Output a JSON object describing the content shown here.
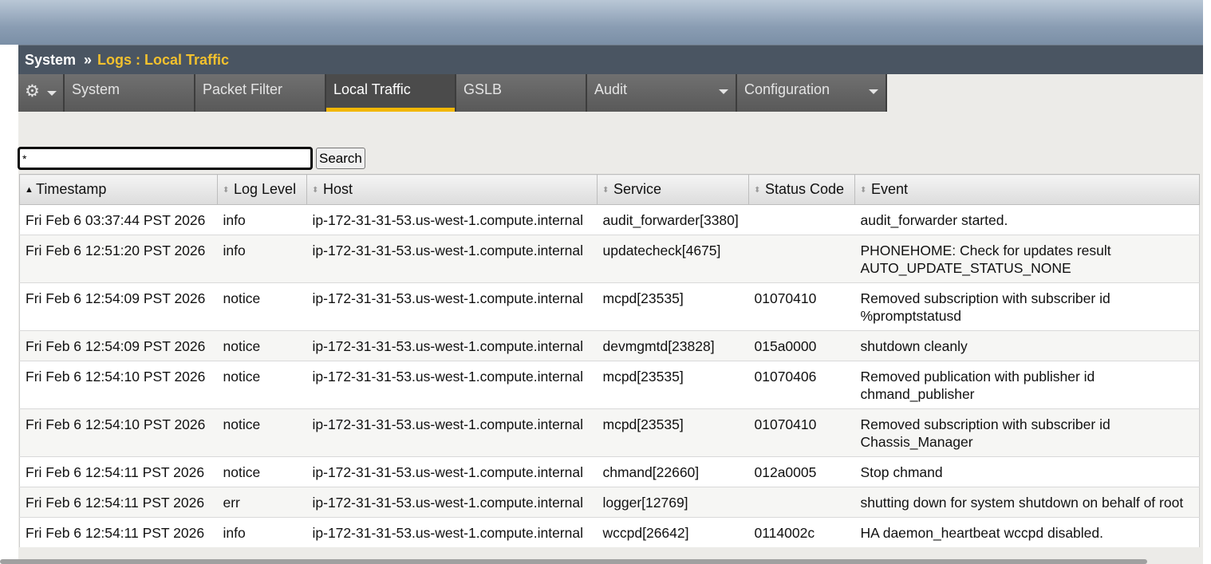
{
  "breadcrumb": {
    "root": "System",
    "separator": "››",
    "current": "Logs : Local Traffic"
  },
  "tabs": [
    {
      "label": "",
      "icon": "gear-icon",
      "has_dropdown": true
    },
    {
      "label": "System",
      "has_dropdown": false
    },
    {
      "label": "Packet Filter",
      "has_dropdown": false
    },
    {
      "label": "Local Traffic",
      "has_dropdown": false,
      "active": true
    },
    {
      "label": "GSLB",
      "has_dropdown": false
    },
    {
      "label": "Audit",
      "has_dropdown": true
    },
    {
      "label": "Configuration",
      "has_dropdown": true
    }
  ],
  "search": {
    "value": "*",
    "button_label": "Search"
  },
  "table": {
    "columns": [
      "Timestamp",
      "Log Level",
      "Host",
      "Service",
      "Status Code",
      "Event"
    ],
    "sorted_column": "Timestamp",
    "rows": [
      {
        "timestamp": "Fri Feb 6 03:37:44 PST 2026",
        "level": "info",
        "host": "ip-172-31-31-53.us-west-1.compute.internal",
        "service": "audit_forwarder[3380]",
        "status_code": "",
        "event": "audit_forwarder started."
      },
      {
        "timestamp": "Fri Feb 6 12:51:20 PST 2026",
        "level": "info",
        "host": "ip-172-31-31-53.us-west-1.compute.internal",
        "service": "updatecheck[4675]",
        "status_code": "",
        "event": "PHONEHOME: Check for updates result AUTO_UPDATE_STATUS_NONE"
      },
      {
        "timestamp": "Fri Feb 6 12:54:09 PST 2026",
        "level": "notice",
        "host": "ip-172-31-31-53.us-west-1.compute.internal",
        "service": "mcpd[23535]",
        "status_code": "01070410",
        "event": "Removed subscription with subscriber id %promptstatusd"
      },
      {
        "timestamp": "Fri Feb 6 12:54:09 PST 2026",
        "level": "notice",
        "host": "ip-172-31-31-53.us-west-1.compute.internal",
        "service": "devmgmtd[23828]",
        "status_code": "015a0000",
        "event": "shutdown cleanly"
      },
      {
        "timestamp": "Fri Feb 6 12:54:10 PST 2026",
        "level": "notice",
        "host": "ip-172-31-31-53.us-west-1.compute.internal",
        "service": "mcpd[23535]",
        "status_code": "01070406",
        "event": "Removed publication with publisher id chmand_publisher"
      },
      {
        "timestamp": "Fri Feb 6 12:54:10 PST 2026",
        "level": "notice",
        "host": "ip-172-31-31-53.us-west-1.compute.internal",
        "service": "mcpd[23535]",
        "status_code": "01070410",
        "event": "Removed subscription with subscriber id Chassis_Manager"
      },
      {
        "timestamp": "Fri Feb 6 12:54:11 PST 2026",
        "level": "notice",
        "host": "ip-172-31-31-53.us-west-1.compute.internal",
        "service": "chmand[22660]",
        "status_code": "012a0005",
        "event": "Stop chmand"
      },
      {
        "timestamp": "Fri Feb 6 12:54:11 PST 2026",
        "level": "err",
        "host": "ip-172-31-31-53.us-west-1.compute.internal",
        "service": "logger[12769]",
        "status_code": "",
        "event": "shutting down for system shutdown on behalf of root"
      },
      {
        "timestamp": "Fri Feb 6 12:54:11 PST 2026",
        "level": "info",
        "host": "ip-172-31-31-53.us-west-1.compute.internal",
        "service": "wccpd[26642]",
        "status_code": "0114002c",
        "event": "HA daemon_heartbeat wccpd disabled."
      }
    ]
  },
  "colors": {
    "accent": "#f2c12e",
    "active_tab_underline": "#f2b705",
    "breadcrumb_bg": "#4a5562",
    "tab_bg": "#595959"
  }
}
